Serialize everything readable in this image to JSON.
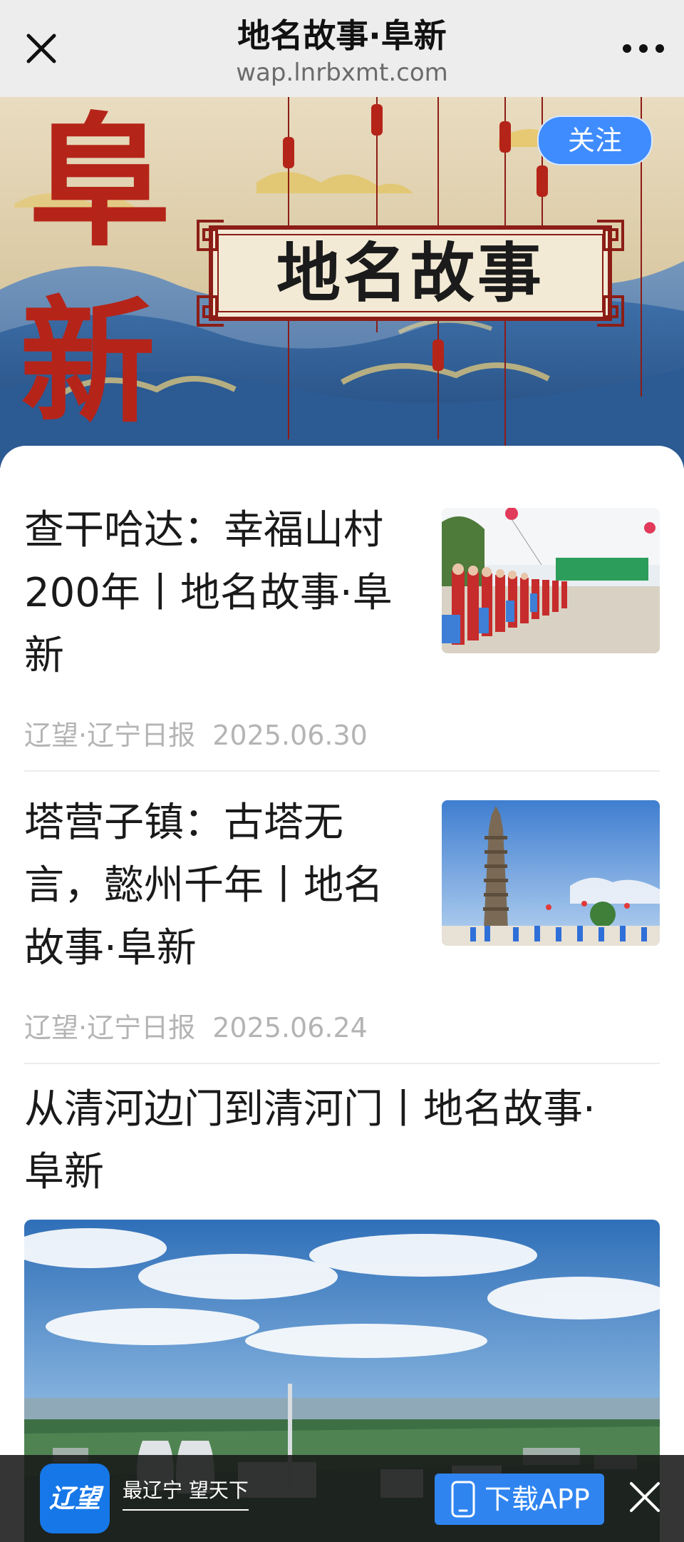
{
  "navbar": {
    "title": "地名故事·阜新",
    "url": "wap.lnrbxmt.com",
    "close_icon": "close-icon",
    "more_icon": "more-icon"
  },
  "banner": {
    "vertical_chars": [
      "阜",
      "新"
    ],
    "title": "地名故事",
    "follow_label": "关注"
  },
  "articles": [
    {
      "title_lines": [
        "查干哈达：幸福山村",
        "200年丨地名故事·阜",
        "新"
      ],
      "meta": "辽望·辽宁日报  2025.06.30"
    },
    {
      "title_lines": [
        "塔营子镇：古塔无",
        "言，懿州千年丨地名",
        "故事·阜新"
      ],
      "meta": "辽望·辽宁日报  2025.06.24"
    },
    {
      "title_lines": [
        "从清河边门到清河门丨地名故事·",
        "阜新"
      ]
    }
  ],
  "app_bar": {
    "logo_text": "辽望",
    "slogan": "最辽宁 望天下",
    "download_label": "下载APP",
    "phone_icon": "phone-icon",
    "close_icon": "close-icon"
  },
  "colors": {
    "accent": "#3f8cff",
    "banner_red": "#b52419",
    "meta_gray": "#b4b4b4"
  }
}
